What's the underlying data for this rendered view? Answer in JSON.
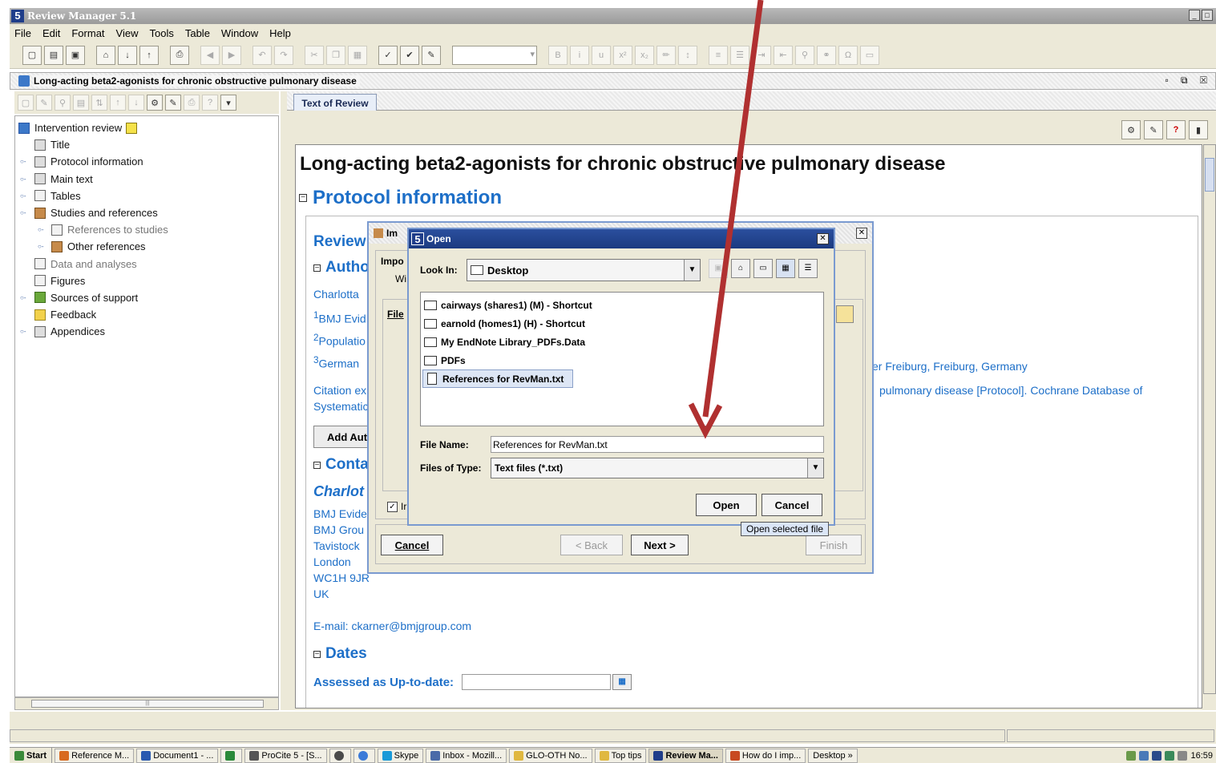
{
  "app": {
    "title": "Review Manager 5.1",
    "icon": "5"
  },
  "menu": [
    "File",
    "Edit",
    "Format",
    "View",
    "Tools",
    "Table",
    "Window",
    "Help"
  ],
  "document": {
    "window_title": "Long-acting beta2-agonists for chronic obstructive pulmonary disease",
    "tab_label": "Text of Review"
  },
  "tree": {
    "items": [
      {
        "label": "Intervention review",
        "icon": "review-icon"
      },
      {
        "label": "Title",
        "icon": "page-icon"
      },
      {
        "label": "Protocol information",
        "icon": "page-icon"
      },
      {
        "label": "Main text",
        "icon": "pages-icon"
      },
      {
        "label": "Tables",
        "icon": "table-icon"
      },
      {
        "label": "Studies and references",
        "icon": "book-icon"
      },
      {
        "label": "References to studies",
        "icon": "references-icon"
      },
      {
        "label": "Other references",
        "icon": "book-icon"
      },
      {
        "label": "Data and analyses",
        "icon": "analysis-icon"
      },
      {
        "label": "Figures",
        "icon": "figure-icon"
      },
      {
        "label": "Sources of support",
        "icon": "support-icon"
      },
      {
        "label": "Feedback",
        "icon": "feedback-icon"
      },
      {
        "label": "Appendices",
        "icon": "appendix-icon"
      }
    ]
  },
  "content": {
    "h1": "Long-acting beta2-agonists for chronic obstructive pulmonary disease",
    "protocol_info": "Protocol information",
    "review_partial": "Review",
    "authors_partial": "Autho",
    "author_name_partial": "Charlotta",
    "affil1_sup": "1",
    "affil1_partial": "BMJ Evid",
    "affil2_sup": "2",
    "affil2_partial": "Populatio",
    "affil3_sup": "3",
    "affil3_partial": "German",
    "affil3_tail": "er Freiburg, Freiburg, Germany",
    "citation_partial": "Citation ex",
    "citation_tail": "pulmonary disease [Protocol]. Cochrane Database of",
    "systematic_partial": "Systematic",
    "add_author_partial": "Add Aut",
    "contact_partial": "Conta",
    "contact_name_partial": "Charlot",
    "address": [
      "BMJ Evide",
      "BMJ Grou",
      "Tavistock",
      "London",
      "WC1H 9JR",
      "UK"
    ],
    "email": "E-mail: ckarner@bmjgroup.com",
    "dates": "Dates",
    "assessed": "Assessed as Up-to-date:"
  },
  "wizard": {
    "title_partial": "Im",
    "impo_partial": "Impo",
    "wi_partial": "Wi",
    "file_partial": "File",
    "check_partial": "Ir",
    "cancel": "Cancel",
    "back": "< Back",
    "next": "Next >",
    "finish": "Finish"
  },
  "open_dialog": {
    "title": "Open",
    "look_in_label": "Look In:",
    "look_in_value": "Desktop",
    "files": [
      {
        "name": "cairways (shares1) (M) - Shortcut",
        "type": "folder"
      },
      {
        "name": "earnold (homes1) (H) - Shortcut",
        "type": "folder"
      },
      {
        "name": "My EndNote Library_PDFs.Data",
        "type": "folder"
      },
      {
        "name": "PDFs",
        "type": "folder"
      },
      {
        "name": "References for RevMan.txt",
        "type": "file"
      }
    ],
    "file_name_label": "File Name:",
    "file_name_value": "References for RevMan.txt",
    "files_of_type_label": "Files of Type:",
    "files_of_type_value": "Text files (*.txt)",
    "open": "Open",
    "cancel": "Cancel",
    "tooltip": "Open selected file"
  },
  "taskbar": {
    "start": "Start",
    "items": [
      "Reference M...",
      "Document1 - ...",
      "",
      "ProCite 5 - [S...",
      "",
      "",
      "Skype",
      "Inbox - Mozill...",
      "GLO-OTH No...",
      "Top tips",
      "Review Ma...",
      "How do I imp...",
      "Desktop"
    ],
    "clock": "16:59"
  },
  "colors": {
    "accent_blue": "#1d6fc8",
    "annotation_arrow": "#b03030"
  }
}
